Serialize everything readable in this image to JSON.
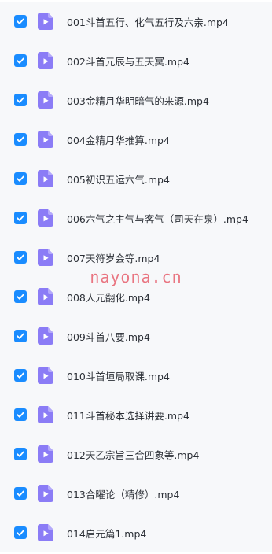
{
  "files": [
    {
      "name": "001斗首五行、化气五行及六亲.mp4",
      "checked": true
    },
    {
      "name": "002斗首元辰与五天冥.mp4",
      "checked": true
    },
    {
      "name": "003金精月华明暗气的来源.mp4",
      "checked": true
    },
    {
      "name": "004金精月华推算.mp4",
      "checked": true
    },
    {
      "name": "005初识五运六气.mp4",
      "checked": true
    },
    {
      "name": "006六气之主气与客气（司天在泉）.mp4",
      "checked": true
    },
    {
      "name": "007天符岁会等.mp4",
      "checked": true
    },
    {
      "name": "008人元翻化.mp4",
      "checked": true
    },
    {
      "name": "009斗首八要.mp4",
      "checked": true
    },
    {
      "name": "010斗首垣局取课.mp4",
      "checked": true
    },
    {
      "name": "011斗首秘本选择讲要.mp4",
      "checked": true
    },
    {
      "name": "012天乙宗旨三合四象等.mp4",
      "checked": true
    },
    {
      "name": "013合曜论（精修）.mp4",
      "checked": true
    },
    {
      "name": "014启元篇1.mp4",
      "checked": true
    }
  ],
  "watermark": "nayona.cn",
  "colors": {
    "checkbox": "#1a8cff",
    "video_icon": "#8b7cf6",
    "row_bg": "#f7f8fa",
    "text": "#2b2f36",
    "watermark": "#e6505f"
  },
  "icons": {
    "checkbox": "checkmark-icon",
    "file": "video-file-icon"
  }
}
